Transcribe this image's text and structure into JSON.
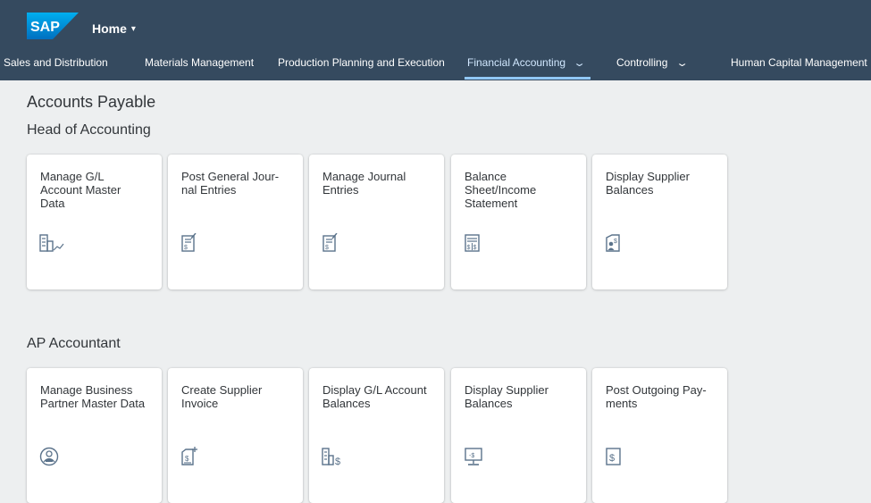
{
  "header": {
    "logo_text": "SAP",
    "home_label": "Home",
    "home_caret": "▾"
  },
  "nav": {
    "items": [
      {
        "label": "Sales and Distribution"
      },
      {
        "label": "Materials Management"
      },
      {
        "label": "Production Planning and Execution"
      },
      {
        "label": "Financial Accounting",
        "active": true
      },
      {
        "label": "Controlling"
      },
      {
        "label": "Human Capital Management"
      }
    ]
  },
  "page": {
    "title": "Accounts Payable"
  },
  "groups": [
    {
      "title": "Head of Accounting",
      "tiles": [
        {
          "title": "Manage G/L\nAccount Master\nData",
          "icon": "building-graph-icon"
        },
        {
          "title": "Post General Jour-\nnal Entries",
          "icon": "document-dollar-icon"
        },
        {
          "title": "Manage Journal\nEntries",
          "icon": "document-dollar-icon"
        },
        {
          "title": "Balance\nSheet/Income\nStatement",
          "icon": "balance-sheet-icon"
        },
        {
          "title": "Display Supplier\nBalances",
          "icon": "supplier-dollar-icon"
        }
      ]
    },
    {
      "title": "AP Accountant",
      "tiles": [
        {
          "title": "Manage Business\nPartner Master Data",
          "icon": "person-circle-icon"
        },
        {
          "title": "Create Supplier\nInvoice",
          "icon": "create-invoice-icon"
        },
        {
          "title": "Display G/L Account\nBalances",
          "icon": "building-dollar-icon"
        },
        {
          "title": "Display Supplier\nBalances",
          "icon": "monitor-dollar-icon"
        },
        {
          "title": "Post Outgoing Pay-\nments",
          "icon": "dollar-box-icon"
        }
      ]
    }
  ],
  "colors": {
    "shell": "#354a5f",
    "background": "#edeff0",
    "tile": "#ffffff",
    "text": "#32363a",
    "icon": "#5b738b",
    "active_underline": "#91c8f6"
  }
}
